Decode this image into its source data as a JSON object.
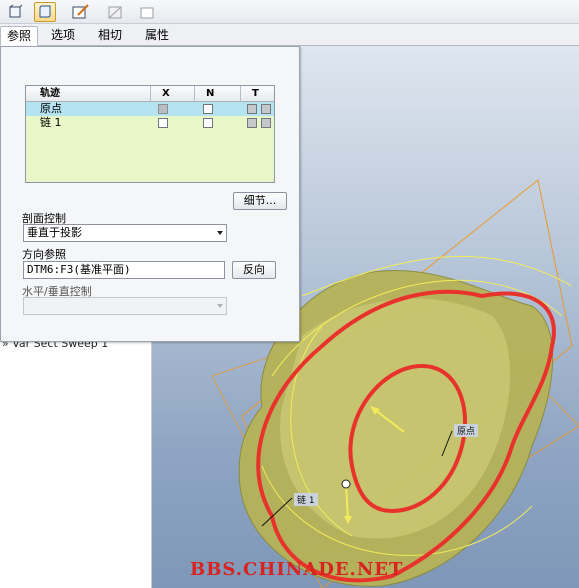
{
  "toolbar": {
    "icons": [
      "solid-icon",
      "sweep-section-icon",
      "sketch-icon",
      "thicken-icon",
      "surface-icon"
    ]
  },
  "tabs": [
    {
      "label": "参照",
      "active": true
    },
    {
      "label": "选项",
      "active": false
    },
    {
      "label": "相切",
      "active": false
    },
    {
      "label": "属性",
      "active": false
    }
  ],
  "panel": {
    "table": {
      "headers": {
        "trajectory": "轨迹",
        "x": "X",
        "n": "N",
        "t": "T"
      },
      "rows": [
        {
          "name": "原点",
          "selected": true
        },
        {
          "name": "链 1",
          "selected": false
        }
      ]
    },
    "details_button": "细节...",
    "section_control_label": "剖面控制",
    "section_control_value": "垂直于投影",
    "direction_ref_label": "方向参照",
    "direction_ref_value": "DTM6:F3(基准平面)",
    "flip_button": "反向",
    "horiz_vert_label": "水平/垂直控制",
    "horiz_vert_value": ""
  },
  "tree": {
    "item": "Var Sect Sweep 1"
  },
  "viewport": {
    "labels": {
      "chain": "链 1",
      "origin": "原点"
    },
    "colors": {
      "trajectory": "#e8322c",
      "surface": "#c7c66a",
      "datum": "#e89a2a"
    }
  },
  "watermark": "BBS.CHINADE.NET"
}
